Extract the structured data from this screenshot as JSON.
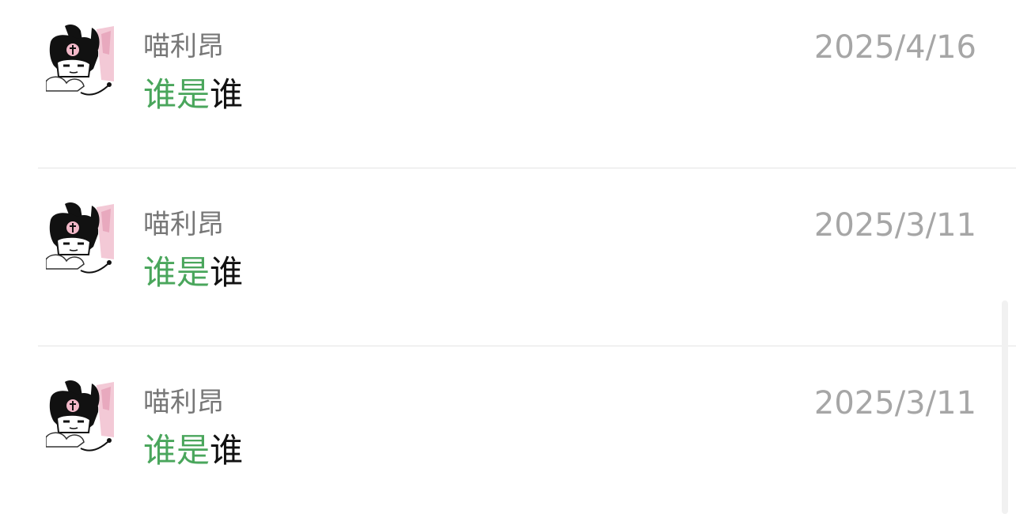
{
  "items": [
    {
      "name": "喵利昂",
      "date": "2025/4/16",
      "message_highlight": "谁是",
      "message_text": "谁",
      "avatar_icon": "avatar-image"
    },
    {
      "name": "喵利昂",
      "date": "2025/3/11",
      "message_highlight": "谁是",
      "message_text": "谁",
      "avatar_icon": "avatar-image"
    },
    {
      "name": "喵利昂",
      "date": "2025/3/11",
      "message_highlight": "谁是",
      "message_text": "谁",
      "avatar_icon": "avatar-image"
    }
  ],
  "colors": {
    "highlight": "#4aa65c",
    "name": "#777777",
    "date": "#a6a6a6",
    "text": "#111111",
    "divider": "#e3e3e3"
  }
}
